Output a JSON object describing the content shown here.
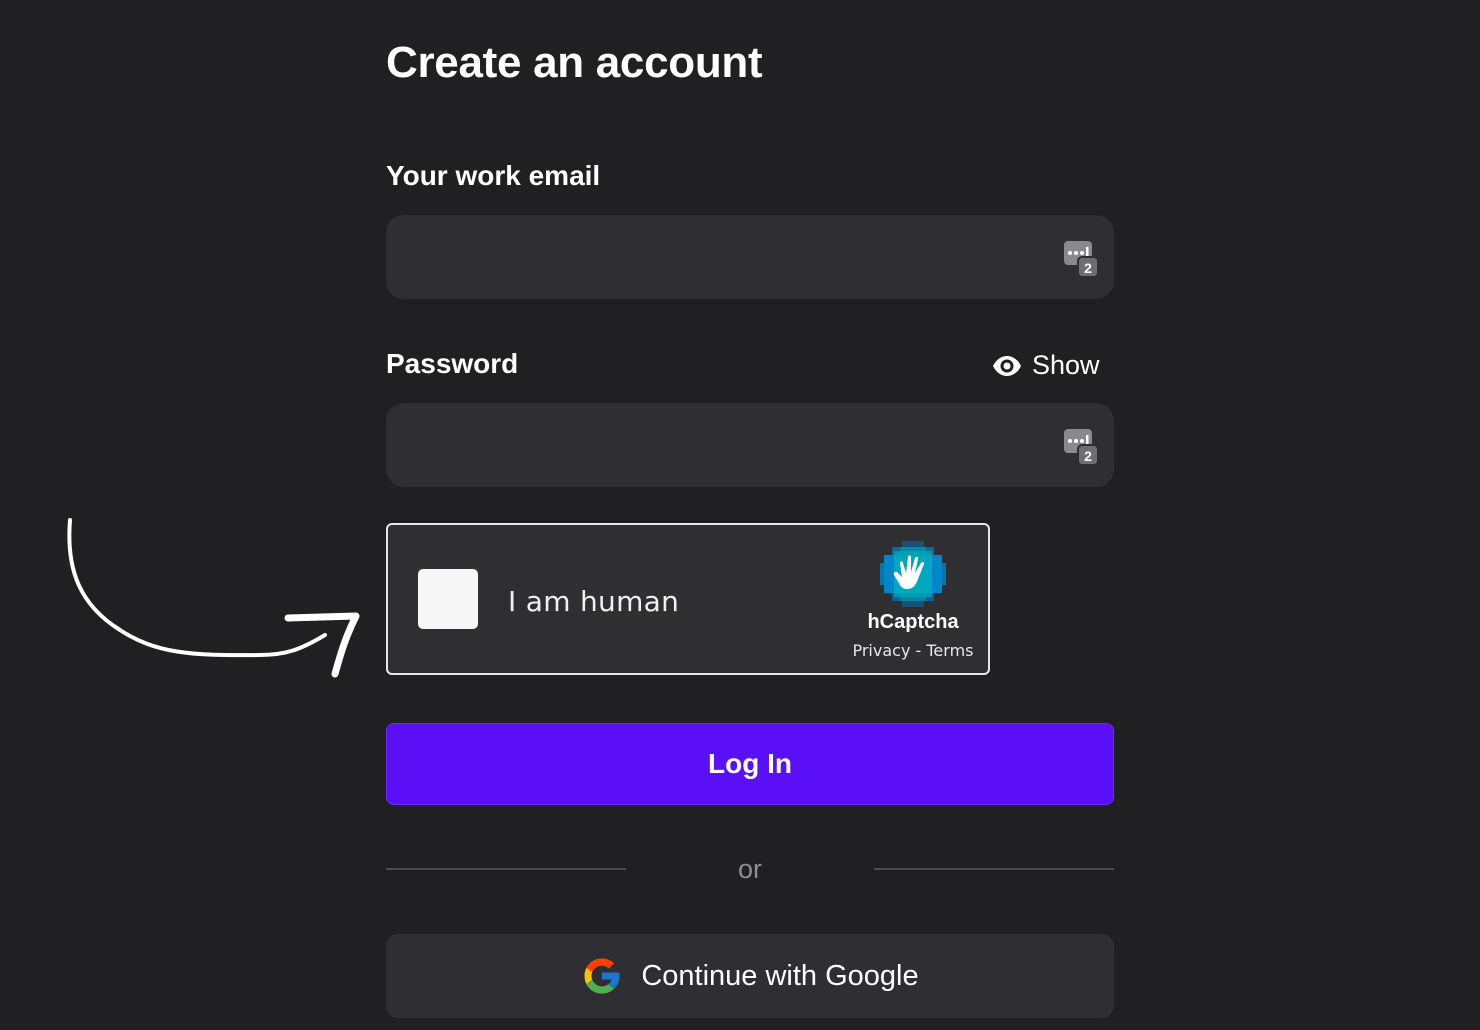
{
  "form": {
    "title": "Create an account",
    "email_label": "Your work email",
    "email_value": "",
    "email_placeholder": "",
    "password_label": "Password",
    "password_value": "",
    "password_placeholder": "",
    "show_label": "Show"
  },
  "captcha": {
    "checkbox_label": "I am human",
    "brand": "hCaptcha",
    "privacy_link": "Privacy",
    "separator": " - ",
    "terms_link": "Terms"
  },
  "actions": {
    "login_label": "Log In",
    "divider_text": "or",
    "google_label": "Continue with Google"
  },
  "colors": {
    "background": "#202023",
    "input_background": "#2f2f33",
    "primary": "#5b0ff7",
    "divider": "#4a4a4e",
    "muted_text": "#8d8d92"
  },
  "icons": {
    "eye": "eye-icon",
    "password_manager": "password-manager-icon",
    "captcha_logo": "hcaptcha-logo-icon",
    "google": "google-g-icon",
    "annotation": "hand-drawn-arrow-icon"
  }
}
